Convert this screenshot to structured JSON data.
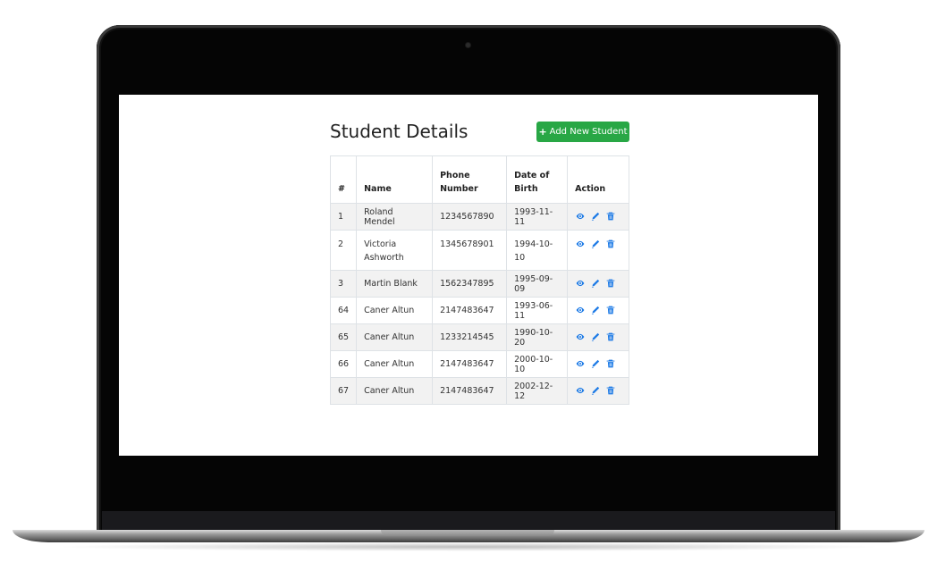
{
  "page": {
    "title": "Student Details",
    "add_button_label": "Add New Student",
    "add_button_icon": "plus-icon"
  },
  "table": {
    "headers": [
      "#",
      "Name",
      "Phone Number",
      "Date of Birth",
      "Action"
    ],
    "rows": [
      {
        "id": "1",
        "name": "Roland Mendel",
        "phone": "1234567890",
        "dob": "1993-11-11"
      },
      {
        "id": "2",
        "name": "Victoria Ashworth",
        "phone": "1345678901",
        "dob": "1994-10-10"
      },
      {
        "id": "3",
        "name": "Martin Blank",
        "phone": "1562347895",
        "dob": "1995-09-09"
      },
      {
        "id": "64",
        "name": "Caner Altun",
        "phone": "2147483647",
        "dob": "1993-06-11"
      },
      {
        "id": "65",
        "name": "Caner Altun",
        "phone": "1233214545",
        "dob": "1990-10-20"
      },
      {
        "id": "66",
        "name": "Caner Altun",
        "phone": "2147483647",
        "dob": "2000-10-10"
      },
      {
        "id": "67",
        "name": "Caner Altun",
        "phone": "2147483647",
        "dob": "2002-12-12"
      }
    ],
    "row_actions": [
      "view-icon",
      "edit-icon",
      "delete-icon"
    ]
  },
  "colors": {
    "accent_button": "#28a745",
    "action_icon": "#1e7be6",
    "row_stripe": "#f2f2f2"
  }
}
